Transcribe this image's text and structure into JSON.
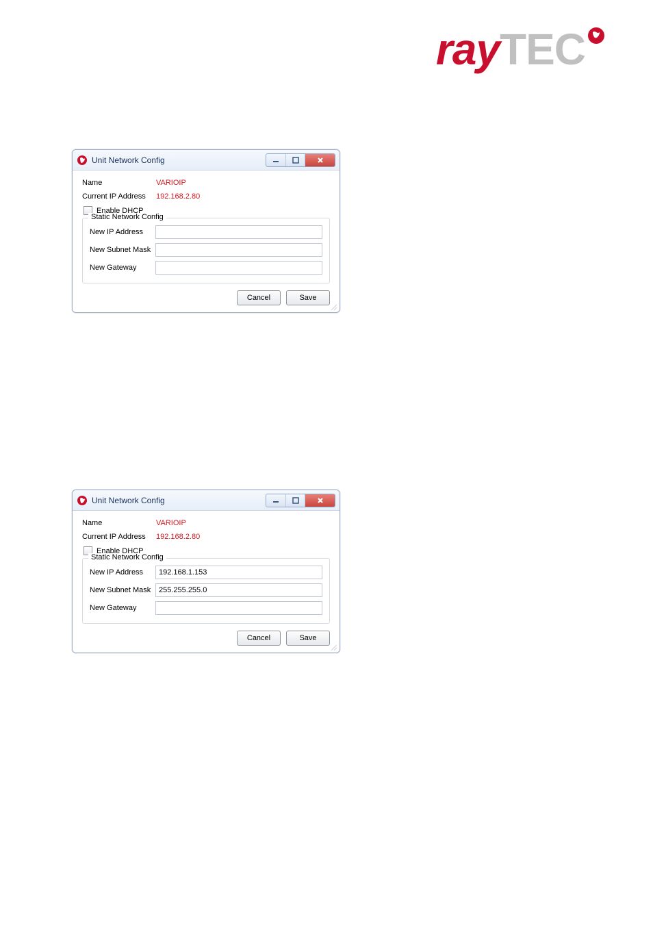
{
  "logo": {
    "ray": "ray",
    "tec": "TEC"
  },
  "windows": [
    {
      "title": "Unit Network Config",
      "name_label": "Name",
      "name_value": "VARIOIP",
      "ip_label": "Current IP Address",
      "ip_value": "192.168.2.80",
      "dhcp_label": "Enable DHCP",
      "fieldset_title": "Static Network Config",
      "fields": {
        "new_ip_label": "New IP Address",
        "new_ip_value": "",
        "new_mask_label": "New Subnet Mask",
        "new_mask_value": "",
        "new_gw_label": "New Gateway",
        "new_gw_value": ""
      },
      "cancel": "Cancel",
      "save": "Save"
    },
    {
      "title": "Unit Network Config",
      "name_label": "Name",
      "name_value": "VARIOIP",
      "ip_label": "Current IP Address",
      "ip_value": "192.168.2.80",
      "dhcp_label": "Enable DHCP",
      "fieldset_title": "Static Network Config",
      "fields": {
        "new_ip_label": "New IP Address",
        "new_ip_value": "192.168.1.153",
        "new_mask_label": "New Subnet Mask",
        "new_mask_value": "255.255.255.0",
        "new_gw_label": "New Gateway",
        "new_gw_value": ""
      },
      "cancel": "Cancel",
      "save": "Save"
    }
  ]
}
